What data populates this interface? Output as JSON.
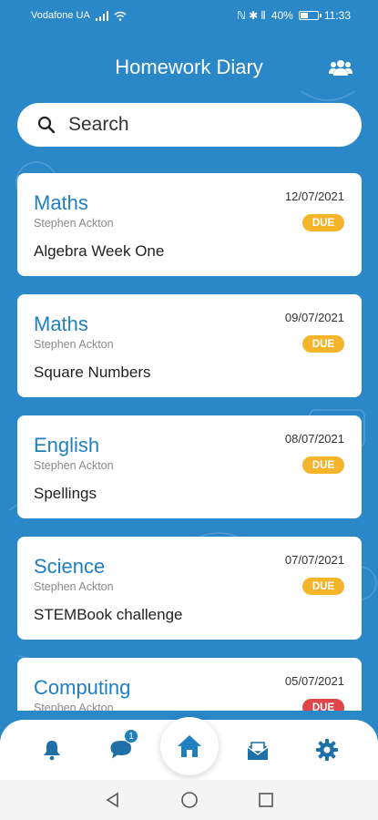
{
  "status_bar": {
    "carrier": "Vodafone UA",
    "right_icons": "ℕ ✱ ⦀",
    "battery_pct": "40%",
    "time": "11:33"
  },
  "header": {
    "title": "Homework Diary",
    "users_icon": "users-icon"
  },
  "search": {
    "placeholder": "Search"
  },
  "homework": [
    {
      "subject": "Maths",
      "teacher": "Stephen Ackton",
      "task": "Algebra Week One",
      "date": "12/07/2021",
      "status": "DUE",
      "status_color": "#f5b52b"
    },
    {
      "subject": "Maths",
      "teacher": "Stephen Ackton",
      "task": "Square Numbers",
      "date": "09/07/2021",
      "status": "DUE",
      "status_color": "#f5b52b"
    },
    {
      "subject": "English",
      "teacher": "Stephen Ackton",
      "task": "Spellings",
      "date": "08/07/2021",
      "status": "DUE",
      "status_color": "#f5b52b"
    },
    {
      "subject": "Science",
      "teacher": "Stephen Ackton",
      "task": "STEMBook challenge",
      "date": "07/07/2021",
      "status": "DUE",
      "status_color": "#f5b52b"
    },
    {
      "subject": "Computing",
      "teacher": "Stephen Ackton",
      "task": "",
      "date": "05/07/2021",
      "status": "DUE",
      "status_color": "#e0454a"
    }
  ],
  "bottom_nav": {
    "items": [
      "bell-icon",
      "chat-icon",
      "home-icon",
      "homework-icon",
      "gear-icon"
    ],
    "message_count": "1",
    "active": "home-icon"
  },
  "colors": {
    "primary": "#2a87c8",
    "accent_text": "#1f7fc1",
    "due_yellow": "#f5b52b",
    "due_red": "#e0454a"
  }
}
